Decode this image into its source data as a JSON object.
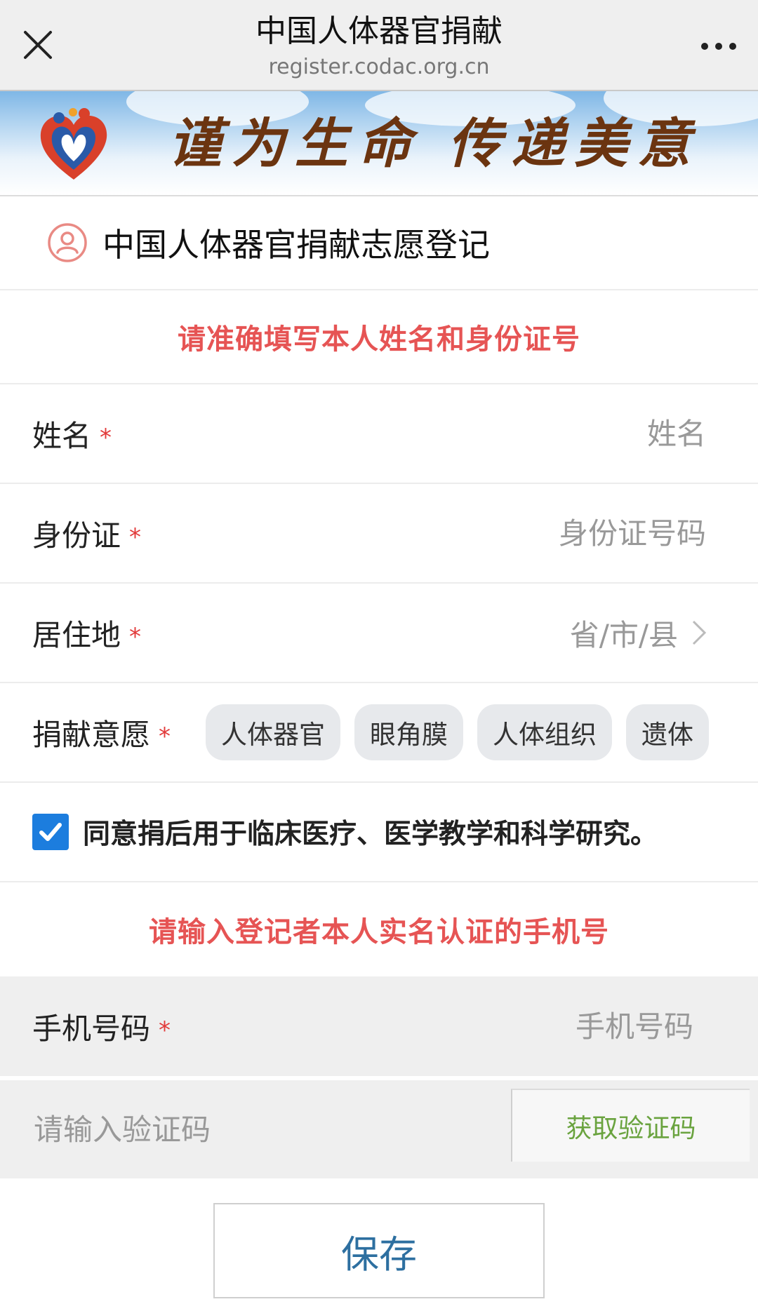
{
  "header": {
    "title": "中国人体器官捐献",
    "url": "register.codac.org.cn"
  },
  "banner": {
    "slogan_left": "谨为生命",
    "slogan_right": "传递美意"
  },
  "form": {
    "title": "中国人体器官捐献志愿登记",
    "notice_id": "请准确填写本人姓名和身份证号",
    "name": {
      "label": "姓名",
      "required": "*",
      "placeholder": "姓名"
    },
    "id_card": {
      "label": "身份证",
      "required": "*",
      "placeholder": "身份证号码"
    },
    "residence": {
      "label": "居住地",
      "required": "*",
      "value": "省/市/县"
    },
    "intent": {
      "label": "捐献意愿",
      "required": "*",
      "options": [
        "人体器官",
        "眼角膜",
        "人体组织",
        "遗体"
      ]
    },
    "agree_text": "同意捐后用于临床医疗、医学教学和科学研究。",
    "agree_checked": true,
    "notice_phone": "请输入登记者本人实名认证的手机号",
    "phone": {
      "label": "手机号码",
      "required": "*",
      "placeholder": "手机号码"
    },
    "code": {
      "placeholder": "请输入验证码",
      "button": "获取验证码"
    },
    "save_label": "保存"
  },
  "colors": {
    "notice": "#e65454",
    "required": "#e23b3b",
    "checkbox": "#1c7dde",
    "get_code": "#6aa33f",
    "save": "#2d6fa0",
    "slogan": "#6b3410"
  }
}
